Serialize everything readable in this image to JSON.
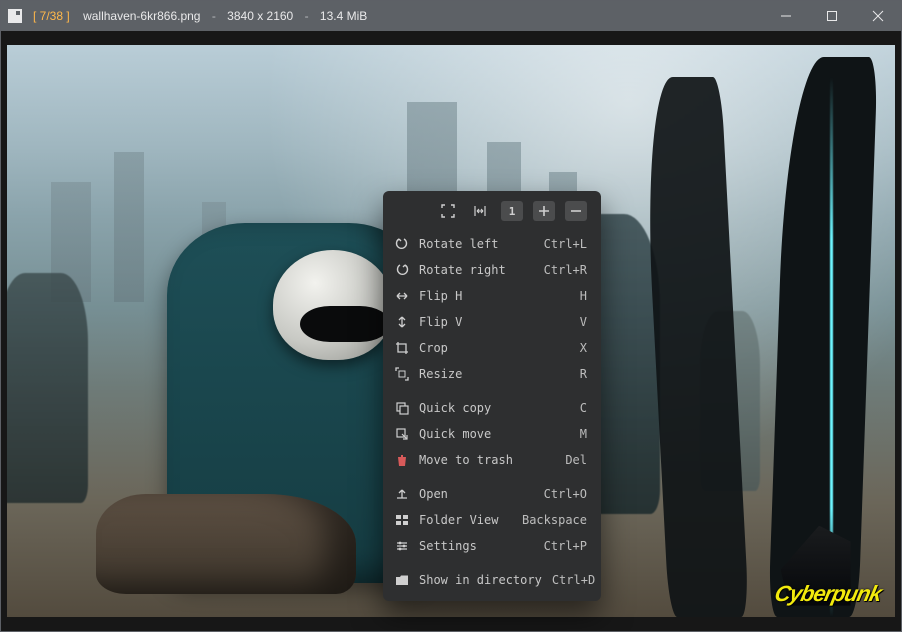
{
  "title": {
    "count": "[ 7/38 ]",
    "filename": "wallhaven-6kr866.png",
    "separator": "-",
    "dimensions": "3840 x 2160",
    "size": "13.4 MiB"
  },
  "image_logo": "Cyberpunk",
  "toolbar": {
    "scale_number": "1"
  },
  "menu": {
    "items": [
      {
        "icon": "rotate-left-icon",
        "label": "Rotate left",
        "shortcut": "Ctrl+L",
        "name": "rotate-left"
      },
      {
        "icon": "rotate-right-icon",
        "label": "Rotate right",
        "shortcut": "Ctrl+R",
        "name": "rotate-right"
      },
      {
        "icon": "flip-h-icon",
        "label": "Flip H",
        "shortcut": "H",
        "name": "flip-h"
      },
      {
        "icon": "flip-v-icon",
        "label": "Flip V",
        "shortcut": "V",
        "name": "flip-v"
      },
      {
        "icon": "crop-icon",
        "label": "Crop",
        "shortcut": "X",
        "name": "crop"
      },
      {
        "icon": "resize-icon",
        "label": "Resize",
        "shortcut": "R",
        "name": "resize"
      },
      {
        "icon": "copy-icon",
        "label": "Quick copy",
        "shortcut": "C",
        "name": "quick-copy",
        "sep": true
      },
      {
        "icon": "move-icon",
        "label": "Quick move",
        "shortcut": "M",
        "name": "quick-move"
      },
      {
        "icon": "trash-icon",
        "label": "Move to trash",
        "shortcut": "Del",
        "name": "move-to-trash"
      },
      {
        "icon": "open-icon",
        "label": "Open",
        "shortcut": "Ctrl+O",
        "name": "open",
        "sep": true
      },
      {
        "icon": "folder-view-icon",
        "label": "Folder View",
        "shortcut": "Backspace",
        "name": "folder-view"
      },
      {
        "icon": "settings-icon",
        "label": "Settings",
        "shortcut": "Ctrl+P",
        "name": "settings"
      },
      {
        "icon": "show-dir-icon",
        "label": "Show in directory",
        "shortcut": "Ctrl+D",
        "name": "show-in-directory",
        "sep": true
      }
    ]
  }
}
